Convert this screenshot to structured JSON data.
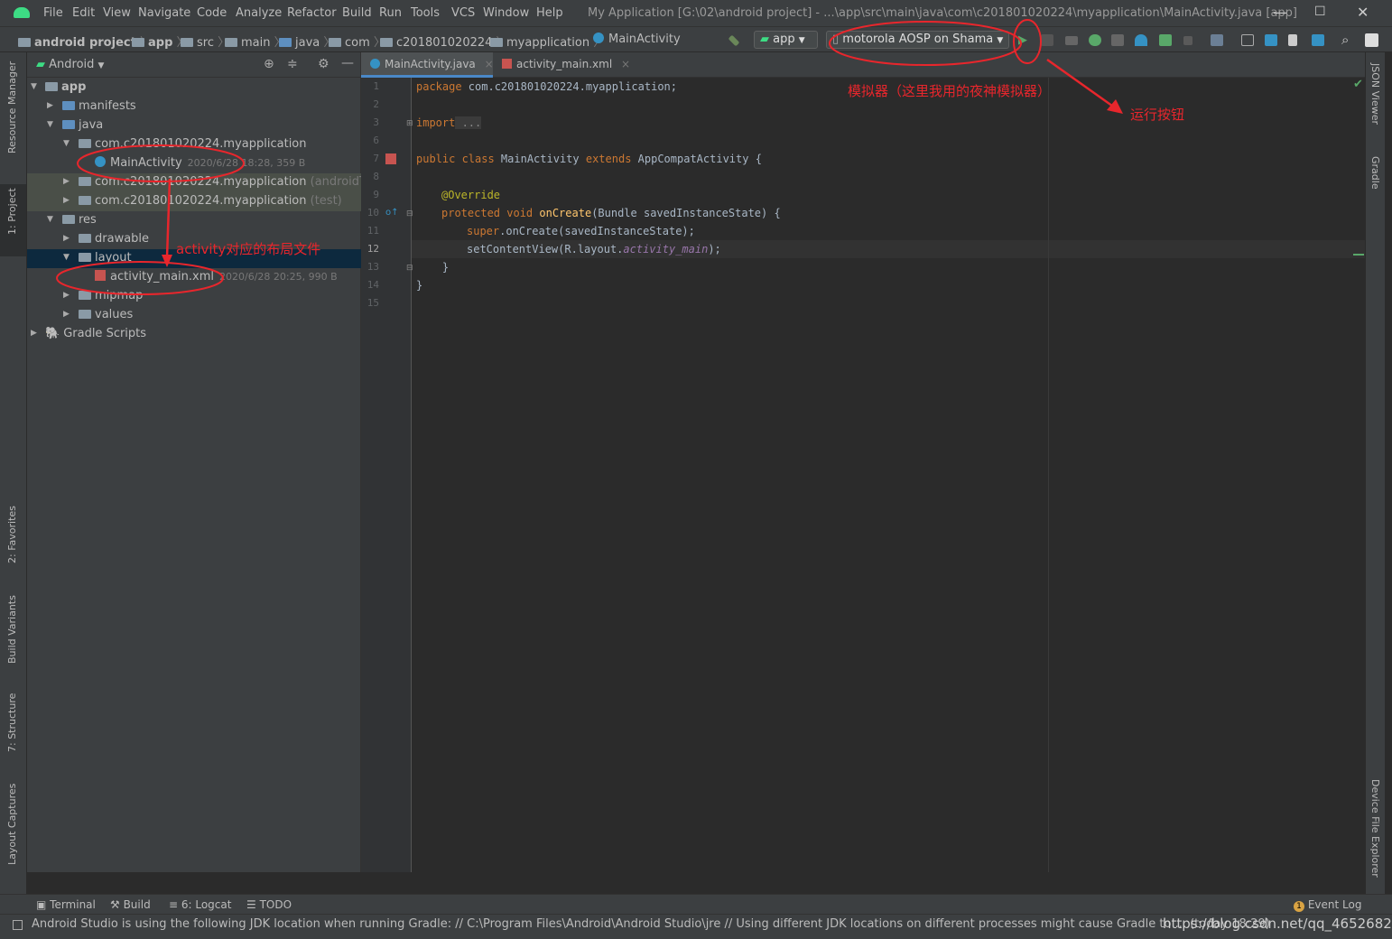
{
  "menu": {
    "items": [
      "File",
      "Edit",
      "View",
      "Navigate",
      "Code",
      "Analyze",
      "Refactor",
      "Build",
      "Run",
      "Tools",
      "VCS",
      "Window",
      "Help"
    ],
    "window_title": "My Application [G:\\02\\android project] - ...\\app\\src\\main\\java\\com\\c201801020224\\myapplication\\MainActivity.java [app]"
  },
  "breadcrumb": [
    "android project",
    "app",
    "src",
    "main",
    "java",
    "com",
    "c201801020224",
    "myapplication",
    "MainActivity"
  ],
  "toolbar": {
    "config": "app",
    "device": "motorola AOSP on Shama"
  },
  "project_panel": {
    "view_label": "Android",
    "tree": [
      {
        "label": "app",
        "bold": true
      },
      {
        "label": "manifests"
      },
      {
        "label": "java"
      },
      {
        "label": "com.c201801020224.myapplication"
      },
      {
        "label": "MainActivity",
        "meta": "2020/6/28 18:28, 359 B"
      },
      {
        "label": "com.c201801020224.myapplication",
        "tag": "(androidTest)"
      },
      {
        "label": "com.c201801020224.myapplication",
        "tag": "(test)"
      },
      {
        "label": "res"
      },
      {
        "label": "drawable"
      },
      {
        "label": "layout"
      },
      {
        "label": "activity_main.xml",
        "meta": "2020/6/28 20:25, 990 B"
      },
      {
        "label": "mipmap"
      },
      {
        "label": "values"
      },
      {
        "label": "Gradle Scripts"
      }
    ]
  },
  "editor": {
    "tabs": [
      "MainActivity.java",
      "activity_main.xml"
    ],
    "line_numbers": [
      "1",
      "2",
      "3",
      "6",
      "7",
      "8",
      "9",
      "10",
      "11",
      "12",
      "13",
      "14",
      "15"
    ],
    "code": {
      "l1_kw": "package",
      "l1_rest": " com.c201801020224.myapplication;",
      "l3_kw": "import",
      "l3_rest": " ...",
      "l7_kw": "public class",
      "l7_mid": " MainActivity ",
      "l7_kw2": "extends",
      "l7_rest": " AppCompatActivity {",
      "l9_ann": "@Override",
      "l10_kw": "protected void",
      "l10_fn": " onCreate",
      "l10_rest": "(Bundle savedInstanceState) {",
      "l11_kw": "super",
      "l11_rest": ".onCreate(savedInstanceState);",
      "l12_a": "setContentView(R.layout.",
      "l12_it": "activity_main",
      "l12_b": ");",
      "l13": "    }",
      "l14": "}"
    }
  },
  "annotations": {
    "emulator": "模拟器（这里我用的夜神模拟器）",
    "run_button": "运行按钮",
    "layout_file": "activity对应的布局文件"
  },
  "left_tabs": [
    "Resource Manager",
    "1: Project",
    "2: Favorites",
    "Build Variants",
    "7: Structure",
    "Layout Captures"
  ],
  "right_tabs": [
    "JSON Viewer",
    "Gradle",
    "Device File Explorer"
  ],
  "bottom_tools": [
    "Terminal",
    "Build",
    "6: Logcat",
    "TODO",
    "Event Log"
  ],
  "status_text": "Android Studio is using the following JDK location when running Gradle: // C:\\Program Files\\Android\\Android Studio\\jre // Using different JDK locations on different processes might cause Gradle to ... (today 18:29)",
  "watermark": "https://blog.csdn.net/qq_46526828",
  "colors": {
    "annotation_red": "#e8262c",
    "selection": "#0d293e",
    "accent": "#4a88c7"
  }
}
